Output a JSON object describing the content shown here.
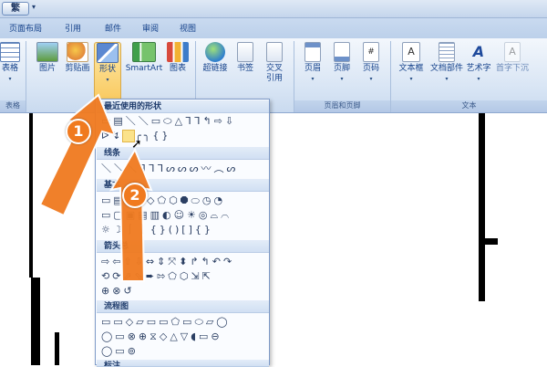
{
  "titlebar": {
    "logo": "繁",
    "qat_dropdown": "▾"
  },
  "tabs": [
    "页面布局",
    "引用",
    "邮件",
    "审阅",
    "视图"
  ],
  "ribbon": {
    "buttons": {
      "table": "表格",
      "picture": "图片",
      "clipart": "剪贴画",
      "shapes": "形状",
      "smartart": "SmartArt",
      "chart": "图表",
      "hyperlink": "超链接",
      "bookmark": "书签",
      "crossref_line1": "交叉",
      "crossref_line2": "引用",
      "header": "页眉",
      "footer": "页脚",
      "pagenum": "页码",
      "textbox": "文本框",
      "quickparts": "文档部件",
      "wordart": "艺术字",
      "dropcap": "首字下沉"
    },
    "groups": {
      "table": "表格",
      "header_footer": "页眉和页脚",
      "text": "文本"
    }
  },
  "shapes_panel": {
    "recent_title": "最近使用的形状",
    "recent_row1": "▭▤＼＼▭⬭△ᒣᒣ↰⇨⇩",
    "recent_row2": "ᐅ↯▢╭╮{}",
    "lines_title": "线条",
    "lines_row": "＼＼＼ᒣᒣᒣᔕᔕᔕ〰︵ᔕ",
    "basic_title": "基本",
    "basic_row1": "▭▤▱⏢◇⬠⬡⯃⬭◷◔",
    "basic_row2": "▭▢▣▤▥◐☺☀◎⌓⌒",
    "basic_row3": "☼☽⎰⎱{}()[]{}",
    "arrows_title": "箭头总",
    "arrows_row1": "⇨⇦⇧⇩⇔⇕⤧⬍↱↰↶↷",
    "arrows_row2": "⟲⟳⬀⬂➨⇰⬠⬡⇲⇱",
    "arrows_row3": "⊕⊗↺",
    "flowchart_title": "流程图",
    "flow_row1": "▭▭◇▱▭▭⬠▭⬭▱◯",
    "flow_row2": "◯▭⊗⊕⧖◇△▽◖▭⊖",
    "flow_row3": "◯▭⊚",
    "callout_title": "标注"
  },
  "annotations": {
    "step1": "1",
    "step2": "2"
  },
  "colors": {
    "arrow": "#f07a1f",
    "active_button": "#f9c95f",
    "ribbon": "#d7e4f4"
  }
}
